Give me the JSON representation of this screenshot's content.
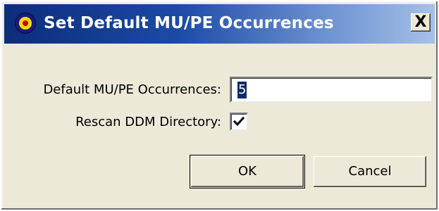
{
  "window": {
    "title": "Set Default MU/PE Occurrences",
    "close_label": "X",
    "titlebar_color_start": "#0c2d7a",
    "titlebar_color_end": "#a6c0e8",
    "background_color": "#ece9d8"
  },
  "form": {
    "occurrences_label": "Default MU/PE Occurrences:",
    "occurrences_value": "5",
    "rescan_label": "Rescan DDM Directory:",
    "rescan_checked": true
  },
  "buttons": {
    "ok_label": "OK",
    "cancel_label": "Cancel"
  },
  "icons": {
    "app": "target-icon",
    "close": "close-icon",
    "check": "check-icon"
  }
}
